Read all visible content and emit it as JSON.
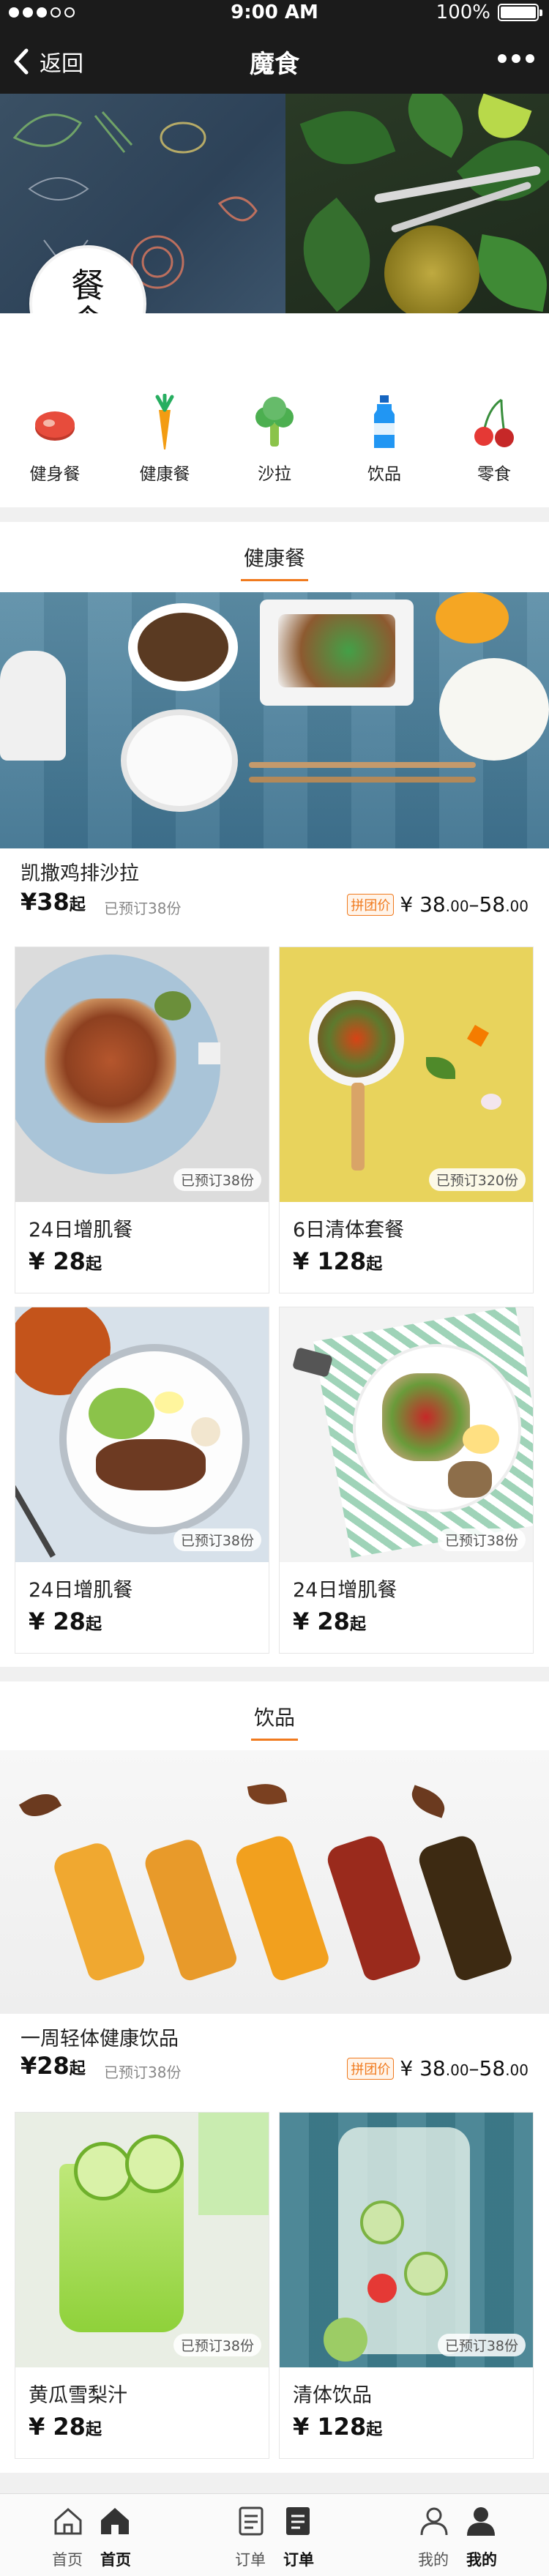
{
  "status": {
    "time": "9:00 AM",
    "battery": "100%"
  },
  "nav": {
    "back_label": "返回",
    "title": "魔食"
  },
  "logo": {
    "text": "餐食"
  },
  "categories": [
    {
      "label": "健身餐",
      "icon": "steak-icon"
    },
    {
      "label": "健康餐",
      "icon": "carrot-icon"
    },
    {
      "label": "沙拉",
      "icon": "broccoli-icon"
    },
    {
      "label": "饮品",
      "icon": "bottle-icon"
    },
    {
      "label": "零食",
      "icon": "cherry-icon"
    }
  ],
  "section1": {
    "title": "健康餐",
    "hero": {
      "name": "凯撒鸡排沙拉",
      "price_symbol": "¥",
      "price": "38",
      "price_suffix": "起",
      "booked": "已预订38份",
      "group_tag": "拼团价",
      "group_low": "38",
      "group_low_dec": ".00",
      "group_sep": "–",
      "group_high": "58",
      "group_high_dec": ".00"
    },
    "cards": [
      {
        "name": "24日增肌餐",
        "price": "28",
        "suffix": "起",
        "booked": "已预订38份"
      },
      {
        "name": "6日清体套餐",
        "price": "128",
        "suffix": "起",
        "booked": "已预订320份"
      },
      {
        "name": "24日增肌餐",
        "price": "28",
        "suffix": "起",
        "booked": "已预订38份"
      },
      {
        "name": "24日增肌餐",
        "price": "28",
        "suffix": "起",
        "booked": "已预订38份"
      }
    ]
  },
  "section2": {
    "title": "饮品",
    "hero": {
      "name": "一周轻体健康饮品",
      "price_symbol": "¥",
      "price": "28",
      "price_suffix": "起",
      "booked": "已预订38份",
      "group_tag": "拼团价",
      "group_low": "38",
      "group_low_dec": ".00",
      "group_sep": "–",
      "group_high": "58",
      "group_high_dec": ".00"
    },
    "cards": [
      {
        "name": "黄瓜雪梨汁",
        "price": "28",
        "suffix": "起",
        "booked": "已预订38份"
      },
      {
        "name": "清体饮品",
        "price": "128",
        "suffix": "起",
        "booked": "已预订38份"
      }
    ]
  },
  "tabbar": [
    {
      "outline": "首页",
      "filled": "首页"
    },
    {
      "outline": "订单",
      "filled": "订单"
    },
    {
      "outline": "我的",
      "filled": "我的"
    }
  ],
  "colors": {
    "accent": "#f07a1e",
    "dark": "#1b1b1b"
  }
}
